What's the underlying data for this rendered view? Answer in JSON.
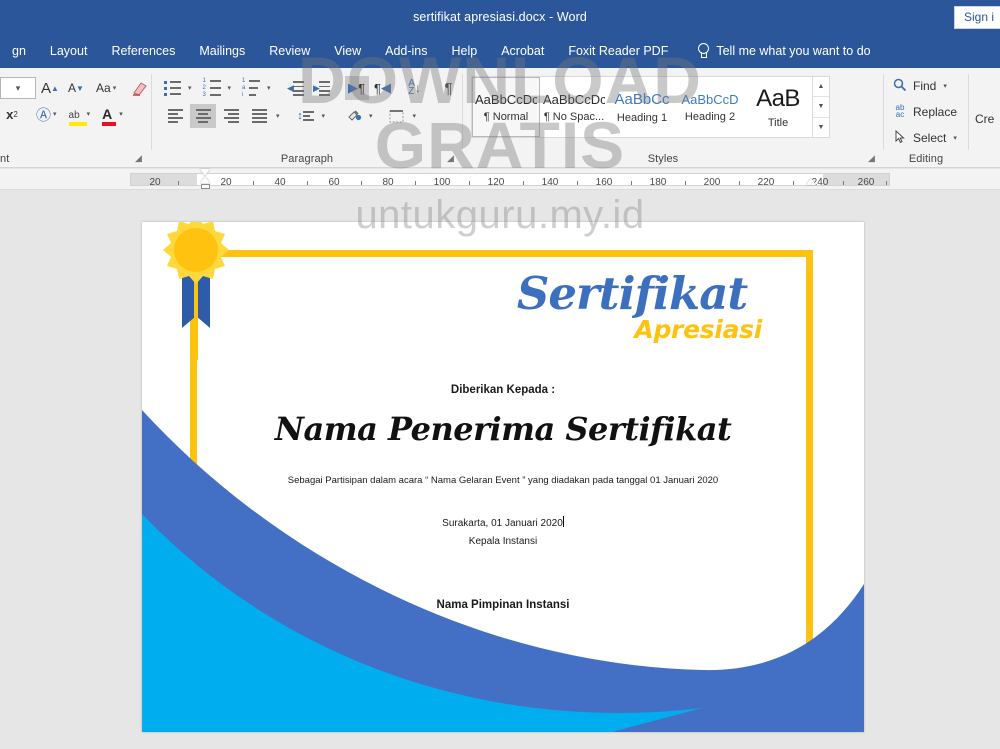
{
  "titlebar": {
    "document_title": "sertifikat apresiasi.docx  -  Word",
    "signin_label": "Sign i"
  },
  "ribbon_tabs": [
    {
      "label": "gn"
    },
    {
      "label": "Layout"
    },
    {
      "label": "References"
    },
    {
      "label": "Mailings"
    },
    {
      "label": "Review"
    },
    {
      "label": "View"
    },
    {
      "label": "Add-ins"
    },
    {
      "label": "Help"
    },
    {
      "label": "Acrobat"
    },
    {
      "label": "Foxit Reader PDF"
    }
  ],
  "tellme": {
    "icon": "lightbulb-icon",
    "label": "Tell me what you want to do"
  },
  "font_group": {
    "label": "nt",
    "grow_font": "A",
    "shrink_font": "A",
    "change_case": "Aa",
    "clear_formatting": "clear-formatting-icon",
    "superscript": "x",
    "superscript_sup": "2",
    "text_effects": "A",
    "highlight": "ab",
    "font_color": "A",
    "launcher": "◢"
  },
  "paragraph_group": {
    "label": "Paragraph",
    "buttons": [
      "bullets-icon",
      "numbering-icon",
      "multilevel-list-icon",
      "decrease-indent-icon",
      "increase-indent-icon",
      "ltr-text-icon",
      "rtl-text-icon",
      "sort-icon",
      "show-marks-icon",
      "align-left-icon",
      "align-center-icon",
      "align-right-icon",
      "justify-icon",
      "line-spacing-icon",
      "shading-icon",
      "borders-icon"
    ],
    "launcher": "◢"
  },
  "styles_group": {
    "label": "Styles",
    "items": [
      {
        "preview": "AaBbCcDc",
        "name": "¶ Normal",
        "active": true
      },
      {
        "preview": "AaBbCcDc",
        "name": "¶ No Spac...",
        "active": false
      },
      {
        "preview": "AaBbCc",
        "name": "Heading 1",
        "active": false
      },
      {
        "preview": "AaBbCcD",
        "name": "Heading 2",
        "active": false
      },
      {
        "preview": "AaB",
        "name": "Title",
        "active": false
      }
    ],
    "scroll_up": "▲",
    "scroll_down": "▼",
    "more": "▬",
    "launcher": "◢"
  },
  "editing_group": {
    "label": "Editing",
    "find_label": "Find",
    "find_icon": "magnifier-icon",
    "find_caret": "▾",
    "replace_label": "Replace",
    "replace_icon": "replace-icon",
    "select_label": "Select",
    "select_icon": "cursor-arrow-icon",
    "select_caret": "▾",
    "create_label": "Cre"
  },
  "ruler": {
    "ticks": [
      {
        "label": "20",
        "pos": 20
      },
      {
        "label": "",
        "pos": 55
      },
      {
        "label": "",
        "pos": 90
      },
      {
        "label": "20",
        "pos": 125
      },
      {
        "label": "",
        "pos": 160
      },
      {
        "label": "40",
        "pos": 195
      },
      {
        "label": "",
        "pos": 230
      },
      {
        "label": "60",
        "pos": 265
      },
      {
        "label": "",
        "pos": 300
      },
      {
        "label": "80",
        "pos": 335
      },
      {
        "label": "",
        "pos": 370
      },
      {
        "label": "100",
        "pos": 405
      },
      {
        "label": "",
        "pos": 440
      },
      {
        "label": "120",
        "pos": 475
      },
      {
        "label": "",
        "pos": 510
      },
      {
        "label": "140",
        "pos": 545
      },
      {
        "label": "",
        "pos": 580
      },
      {
        "label": "160",
        "pos": 615
      },
      {
        "label": "",
        "pos": 650
      },
      {
        "label": "180",
        "pos": 685
      },
      {
        "label": "",
        "pos": 720
      },
      {
        "label": "200",
        "pos": 755
      },
      {
        "label": "",
        "pos": 790
      },
      {
        "label": "220",
        "pos": 825
      },
      {
        "label": "",
        "pos": 860
      },
      {
        "label": "240",
        "pos": 895
      },
      {
        "label": "",
        "pos": 930
      },
      {
        "label": "260",
        "pos": 965
      },
      {
        "label": "",
        "pos": 1000
      }
    ],
    "left_indent_marker": "indent-hourglass-icon",
    "right_indent_marker": "right-indent-icon"
  },
  "certificate": {
    "badge": "award-medal-icon",
    "title_main": "Sertifikat",
    "title_sub": "Apresiasi",
    "given_to_label": "Diberikan Kepada :",
    "recipient_name": "Nama Penerima Sertifikat",
    "description": "Sebagai Partisipan dalam acara “ Nama Gelaran Event ” yang diadakan pada tanggal 01 Januari 2020",
    "place_date": "Surakarta, 01 Januari 2020",
    "signer_role": "Kepala Instansi",
    "signer_name": "Nama Pimpinan Instansi",
    "colors": {
      "frame_yellow": "#FFC20E",
      "title_blue": "#3d6fbf",
      "wave_royal_blue": "#4370c4",
      "wave_cyan": "#00AEEF",
      "badge_gold": "#FFC20E",
      "ribbon_blue": "#2E5CA8"
    }
  },
  "watermark": {
    "line1": "DOWNLOAD",
    "line2": "GRATIS",
    "line3": "untukguru.my.id"
  }
}
